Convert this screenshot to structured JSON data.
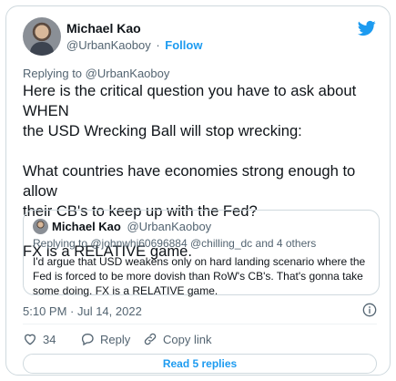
{
  "author": {
    "name": "Michael Kao",
    "handle": "@UrbanKaoboy",
    "separator": "·",
    "follow_label": "Follow"
  },
  "replying_to": {
    "prefix": "Replying to",
    "handle": "@UrbanKaoboy"
  },
  "tweet_text": "Here is the critical question you have to ask about WHEN\nthe USD Wrecking Ball will stop wrecking:\n\nWhat countries have economies strong enough to allow\ntheir CB's to keep up with the Fed?\n\nFX is a RELATIVE game.",
  "quoted": {
    "name": "Michael Kao",
    "handle": "@UrbanKaoboy",
    "replying_line": "Replying to @johnwhi60696884 @chilling_dc and 4 others",
    "text": "I'd argue that USD weakens only on hard landing scenario where the Fed is forced to be more dovish than RoW's CB's. That's gonna take some doing. FX is a RELATIVE game."
  },
  "timestamp": "5:10 PM · Jul 14, 2022",
  "actions": {
    "like_count": "34",
    "reply_label": "Reply",
    "copy_label": "Copy link"
  },
  "read_replies_label": "Read 5 replies",
  "colors": {
    "accent": "#1d9bf0",
    "text": "#0f1419",
    "secondary": "#536471",
    "border": "#cfd9de"
  },
  "icons": [
    "twitter-bird-icon",
    "info-icon",
    "heart-icon",
    "reply-icon",
    "link-icon"
  ]
}
